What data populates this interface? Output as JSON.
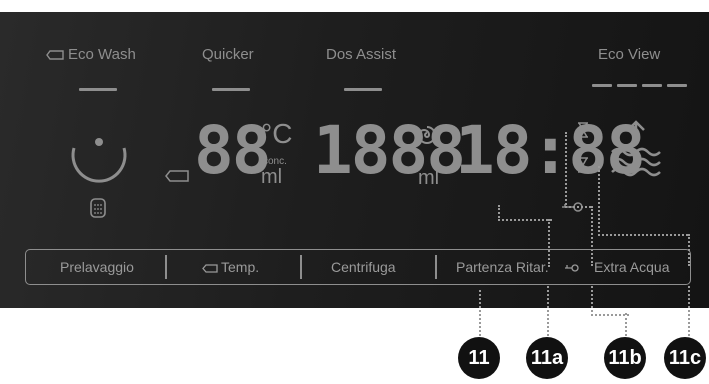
{
  "top_buttons": {
    "eco_wash": "Eco Wash",
    "quicker": "Quicker",
    "dos_assist": "Dos Assist",
    "eco_view": "Eco View"
  },
  "displays": {
    "temp_digits": "88",
    "temp_unit": "°C",
    "conc_label": "conc.",
    "conc_unit": "ml",
    "dose_digits": "1888",
    "dose_unit": "ml",
    "time_digits": "18:88"
  },
  "bottom_bar": {
    "prelavaggio": "Prelavaggio",
    "temp": "Temp.",
    "centrifuga": "Centrifuga",
    "partenza": "Partenza Ritar.",
    "extra_acqua": "Extra Acqua"
  },
  "callouts": [
    "11",
    "11a",
    "11b",
    "11c"
  ],
  "colors": {
    "panel": "#1e1e1e",
    "text": "#8e8e8e",
    "badge": "#111111"
  }
}
